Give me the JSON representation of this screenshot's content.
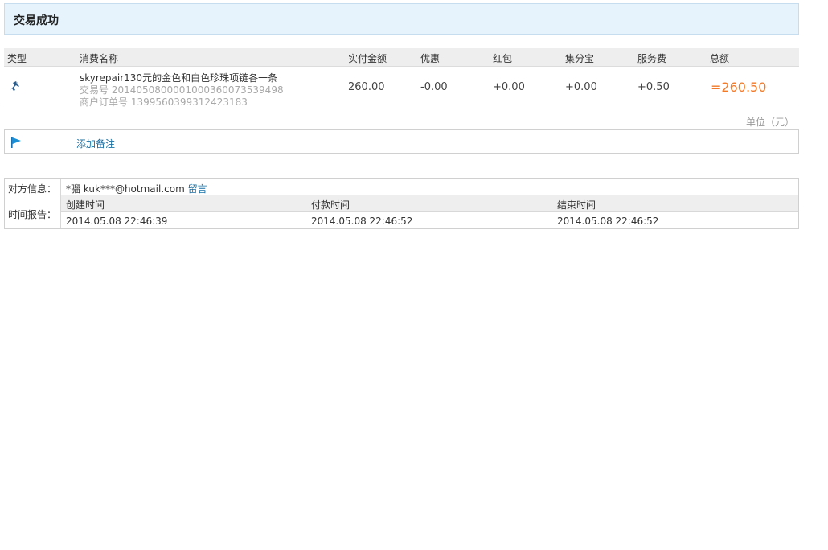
{
  "banner": {
    "title": "交易成功"
  },
  "table": {
    "headers": {
      "type": "类型",
      "name": "消费名称",
      "paid": "实付金额",
      "discount": "优惠",
      "redpack": "红包",
      "jifenbao": "集分宝",
      "fee": "服务费",
      "total": "总额"
    },
    "row": {
      "type_icon": "bird-icon",
      "name": "skyrepair130元的金色和白色珍珠项链各一条",
      "trade_no": "交易号 2014050800001000360073539498",
      "order_no": "商户订单号 1399560399312423183",
      "paid": "260.00",
      "discount": "-0.00",
      "redpack": "+0.00",
      "jifenbao": "+0.00",
      "fee": "+0.50",
      "total": "=260.50"
    }
  },
  "unit": "单位（元）",
  "note": {
    "icon": "flag-icon",
    "add_label": "添加备注"
  },
  "party": {
    "label": "对方信息：",
    "name": "*骝 kuk***@hotmail.com",
    "message_link": "留言"
  },
  "time_report": {
    "label": "时间报告：",
    "columns": [
      {
        "title": "创建时间",
        "value": "2014.05.08 22:46:39"
      },
      {
        "title": "付款时间",
        "value": "2014.05.08 22:46:52"
      },
      {
        "title": "结束时间",
        "value": "2014.05.08 22:46:52"
      }
    ]
  },
  "colors": {
    "total": "#f07a2a",
    "link": "#1a6fa3",
    "banner_bg": "#e6f3fc"
  }
}
